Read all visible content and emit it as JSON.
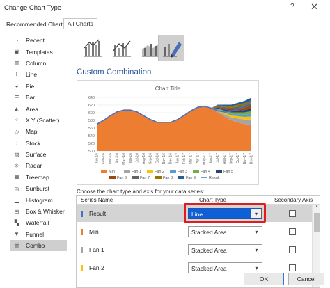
{
  "window": {
    "title": "Change Chart Type",
    "help": "?",
    "close": "✕"
  },
  "tabs": [
    {
      "label": "Recommended Charts"
    },
    {
      "label": "All Charts"
    }
  ],
  "sidebar": {
    "items": [
      {
        "label": "Recent",
        "icon": "recent-icon"
      },
      {
        "label": "Templates",
        "icon": "templates-icon"
      },
      {
        "label": "Column",
        "icon": "column-chart-icon"
      },
      {
        "label": "Line",
        "icon": "line-chart-icon"
      },
      {
        "label": "Pie",
        "icon": "pie-chart-icon"
      },
      {
        "label": "Bar",
        "icon": "bar-chart-icon"
      },
      {
        "label": "Area",
        "icon": "area-chart-icon"
      },
      {
        "label": "X Y (Scatter)",
        "icon": "scatter-chart-icon"
      },
      {
        "label": "Map",
        "icon": "map-chart-icon"
      },
      {
        "label": "Stock",
        "icon": "stock-chart-icon"
      },
      {
        "label": "Surface",
        "icon": "surface-chart-icon"
      },
      {
        "label": "Radar",
        "icon": "radar-chart-icon"
      },
      {
        "label": "Treemap",
        "icon": "treemap-chart-icon"
      },
      {
        "label": "Sunburst",
        "icon": "sunburst-chart-icon"
      },
      {
        "label": "Histogram",
        "icon": "histogram-chart-icon"
      },
      {
        "label": "Box & Whisker",
        "icon": "box-whisker-chart-icon"
      },
      {
        "label": "Waterfall",
        "icon": "waterfall-chart-icon"
      },
      {
        "label": "Funnel",
        "icon": "funnel-chart-icon"
      },
      {
        "label": "Combo",
        "icon": "combo-chart-icon"
      }
    ],
    "selected": "Combo"
  },
  "main": {
    "section_title": "Custom Combination",
    "series_prompt": "Choose the chart type and axis for your data series:",
    "columns": {
      "series_name": "Series Name",
      "chart_type": "Chart Type",
      "secondary_axis": "Secondary Axis"
    },
    "rows": [
      {
        "name": "Result",
        "chart_type": "Line",
        "color": "#4472c4",
        "selected": true
      },
      {
        "name": "Min",
        "chart_type": "Stacked Area",
        "color": "#ed7d31"
      },
      {
        "name": "Fan 1",
        "chart_type": "Stacked Area",
        "color": "#a5a5a5"
      },
      {
        "name": "Fan 2",
        "chart_type": "Stacked Area",
        "color": "#ffc000"
      }
    ]
  },
  "buttons": {
    "ok": "OK",
    "cancel": "Cancel"
  },
  "colors": {
    "accent": "#2b579a",
    "highlight": "#e21c1c",
    "selected_select": "#0f5fd6"
  },
  "chart_data": {
    "type": "area",
    "title": "Chart Title",
    "ylim": [
      500,
      640
    ],
    "y_ticks": [
      "640",
      "620",
      "600",
      "580",
      "560",
      "540",
      "520",
      "500"
    ],
    "categories": [
      "Jan-16",
      "Feb-16",
      "Mar-16",
      "Apr-16",
      "May-16",
      "Jun-16",
      "Jul-16",
      "Aug-16",
      "Sep-16",
      "Oct-16",
      "Nov-16",
      "Dec-16",
      "Jan-17",
      "Feb-17",
      "Mar-17",
      "Apr-17",
      "May-17",
      "Jun-17",
      "Jul-17",
      "Aug-17",
      "Sep-17",
      "Oct-17",
      "Nov-17",
      "Dec-17"
    ],
    "series": [
      {
        "name": "Min",
        "color": "#ed7d31",
        "values": [
          570,
          580,
          592,
          602,
          607,
          607,
          602,
          592,
          582,
          575,
          575,
          575,
          582,
          593,
          605,
          614,
          617,
          612,
          600,
          590,
          580,
          575,
          570,
          568
        ]
      },
      {
        "name": "Fan 1",
        "color": "#a5a5a5",
        "values": [
          0,
          0,
          0,
          0,
          0,
          0,
          0,
          0,
          0,
          0,
          0,
          0,
          0,
          0,
          0,
          0,
          0,
          0,
          4,
          6,
          8,
          10,
          12,
          14
        ]
      },
      {
        "name": "Fan 2",
        "color": "#ffc000",
        "values": [
          0,
          0,
          0,
          0,
          0,
          0,
          0,
          0,
          0,
          0,
          0,
          0,
          0,
          0,
          0,
          0,
          0,
          0,
          3,
          4,
          5,
          6,
          7,
          8
        ]
      },
      {
        "name": "Fan 3",
        "color": "#5b9bd5",
        "values": [
          0,
          0,
          0,
          0,
          0,
          0,
          0,
          0,
          0,
          0,
          0,
          0,
          0,
          0,
          0,
          0,
          0,
          0,
          2,
          3,
          4,
          5,
          6,
          7
        ]
      },
      {
        "name": "Fan 4",
        "color": "#70ad47",
        "values": [
          0,
          0,
          0,
          0,
          0,
          0,
          0,
          0,
          0,
          0,
          0,
          0,
          0,
          0,
          0,
          0,
          0,
          0,
          2,
          3,
          4,
          5,
          6,
          7
        ]
      },
      {
        "name": "Fan 5",
        "color": "#264478",
        "values": [
          0,
          0,
          0,
          0,
          0,
          0,
          0,
          0,
          0,
          0,
          0,
          0,
          0,
          0,
          0,
          0,
          0,
          0,
          2,
          3,
          4,
          5,
          6,
          7
        ]
      },
      {
        "name": "Fan 6",
        "color": "#9e480e",
        "values": [
          0,
          0,
          0,
          0,
          0,
          0,
          0,
          0,
          0,
          0,
          0,
          0,
          0,
          0,
          0,
          0,
          0,
          0,
          2,
          3,
          4,
          5,
          6,
          7
        ]
      },
      {
        "name": "Fan 7",
        "color": "#636363",
        "values": [
          0,
          0,
          0,
          0,
          0,
          0,
          0,
          0,
          0,
          0,
          0,
          0,
          0,
          0,
          0,
          0,
          0,
          0,
          2,
          3,
          4,
          5,
          6,
          7
        ]
      },
      {
        "name": "Fan 8",
        "color": "#997300",
        "values": [
          0,
          0,
          0,
          0,
          0,
          0,
          0,
          0,
          0,
          0,
          0,
          0,
          0,
          0,
          0,
          0,
          0,
          0,
          2,
          3,
          4,
          5,
          6,
          7
        ]
      },
      {
        "name": "Fan 9",
        "color": "#255e91",
        "values": [
          0,
          0,
          0,
          0,
          0,
          0,
          0,
          0,
          0,
          0,
          0,
          0,
          0,
          0,
          0,
          0,
          0,
          0,
          2,
          3,
          4,
          5,
          6,
          7
        ]
      },
      {
        "name": "Result",
        "color": "#4472c4",
        "type": "line",
        "values": [
          570,
          580,
          592,
          602,
          607,
          607,
          602,
          592,
          582,
          575,
          575,
          575,
          582,
          593,
          605,
          614,
          617,
          612,
          605,
          602,
          604,
          610,
          618,
          630
        ]
      }
    ],
    "legend": "bottom"
  }
}
